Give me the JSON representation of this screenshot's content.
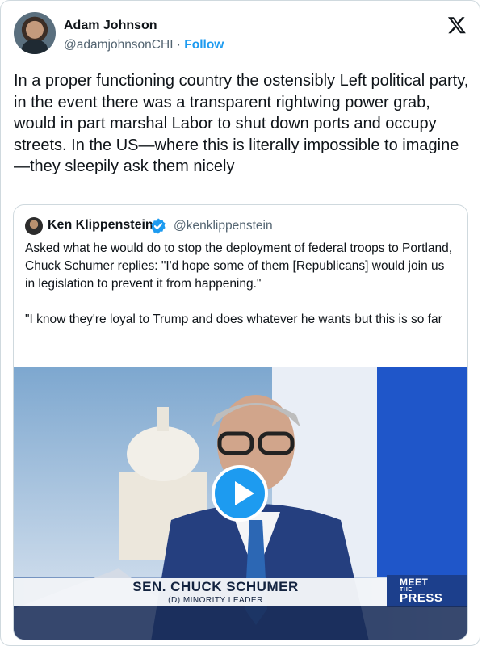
{
  "tweet": {
    "author_name": "Adam Johnson",
    "author_handle": "@adamjohnsonCHI",
    "separator": " · ",
    "follow_label": "Follow",
    "text": "In a proper functioning country the ostensibly Left political party, in the event there was a transparent rightwing power grab, would in part marshal Labor to shut down ports and occupy streets. In the US—where this is literally impossible to imagine—they sleepily ask them nicely"
  },
  "quoted_tweet": {
    "author_name": "Ken Klippenstein",
    "author_handle": "@kenklippenstein",
    "text": "Asked what he would do to stop the deployment of federal troops to Portland, Chuck Schumer replies: \"I'd hope some of them [Republicans] would join us in legislation to prevent it from happening.\"\n\n\"I know they're loyal to Trump and does whatever he wants but this is so far",
    "video": {
      "chyron_name": "SEN. CHUCK SCHUMER",
      "chyron_subtitle": "(D) MINORITY LEADER",
      "logo_line1": "MEET",
      "logo_line2": "THE",
      "logo_line3": "PRESS"
    }
  },
  "icons": {
    "platform_logo": "x-logo-icon",
    "verified": "verified-badge-icon",
    "play": "play-icon",
    "info": "info-icon"
  },
  "colors": {
    "accent": "#1d9bf0",
    "text": "#0f1419",
    "secondary_text": "#536471",
    "border": "#cfd9de"
  }
}
